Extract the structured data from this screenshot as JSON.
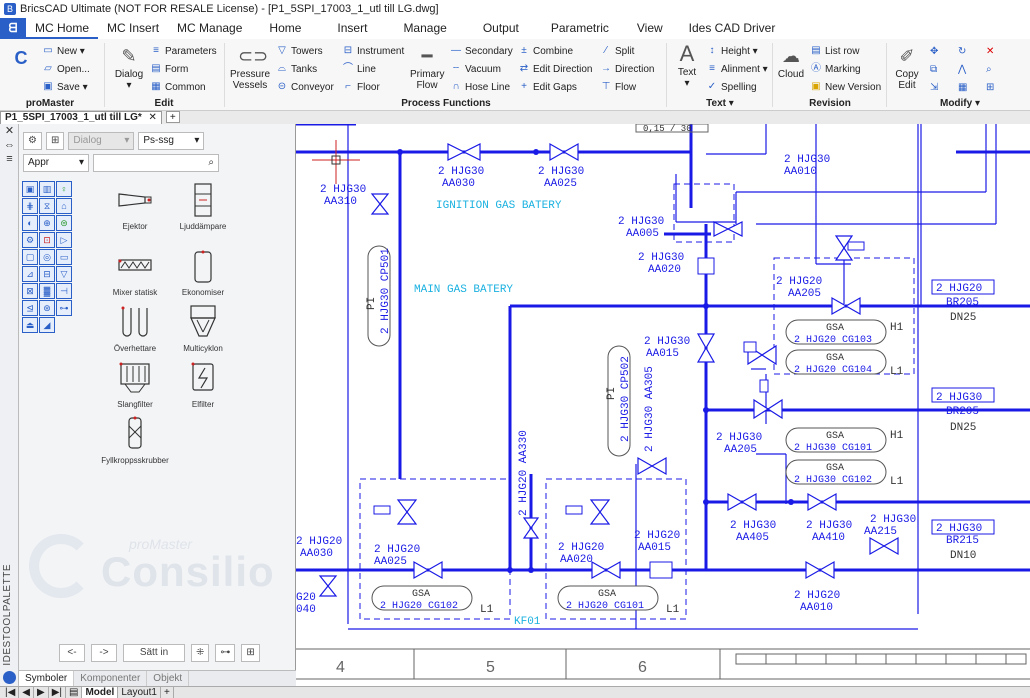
{
  "window": {
    "title": "BricsCAD Ultimate (NOT FOR RESALE License) - [P1_5SPI_17003_1_utl till LG.dwg]"
  },
  "ribbon_tabs": [
    "MC Home",
    "MC Insert",
    "MC Manage",
    "Home",
    "Insert",
    "Manage",
    "Output",
    "Parametric",
    "View",
    "Ides CAD Driver"
  ],
  "ribbon": {
    "promaster": {
      "label": "proMaster",
      "new": "New",
      "open": "Open...",
      "save": "Save"
    },
    "edit": {
      "label": "Edit",
      "dialog": "Dialog",
      "parameters": "Parameters",
      "form": "Form",
      "common": "Common"
    },
    "process": {
      "label": "Process Functions",
      "pressure_vessels": "Pressure Vessels",
      "towers": "Towers",
      "tanks": "Tanks",
      "conveyor": "Conveyor",
      "instrument": "Instrument",
      "line": "Line",
      "floor": "Floor",
      "primary_flow": "Primary Flow",
      "secondary": "Secondary",
      "vacuum": "Vacuum",
      "hose_line": "Hose Line",
      "combine": "Combine",
      "edit_direction": "Edit Direction",
      "edit_gaps": "Edit Gaps",
      "split": "Split",
      "direction": "Direction",
      "flow": "Flow"
    },
    "text": {
      "label": "Text",
      "text": "Text",
      "height": "Height",
      "alignment": "Alinment",
      "spelling": "Spelling"
    },
    "revision": {
      "label": "Revision",
      "cloud": "Cloud",
      "list_row": "List row",
      "marking": "Marking",
      "new_version": "New Version"
    },
    "modify": {
      "label": "Modify",
      "copy_edit": "Copy Edit"
    }
  },
  "doc_tab": {
    "name": "P1_5SPI_17003_1_utl till LG*"
  },
  "palette": {
    "vertical_label": "IDESTOOLPALETTE",
    "dialog_select": "Dialog",
    "std_select": "Ps-ssg",
    "appr_select": "Appr",
    "search_placeholder": "",
    "symbols": [
      "Ejektor",
      "Ljuddämpare",
      "Mixer statisk",
      "Ekonomiser",
      "Överhettare",
      "Multicyklon",
      "Slangfilter",
      "Elfilter",
      "Fyllkroppsskrubber"
    ],
    "watermark_main": "Consilio",
    "watermark_sub": "proMaster",
    "nav_prev": "<-",
    "nav_next": "->",
    "place_button": "Sätt in",
    "tabs": [
      "Symboler",
      "Komponenter",
      "Objekt"
    ]
  },
  "drawing": {
    "labels": {
      "top_box": "0,15 / 30",
      "aa030a": [
        "2 HJG30",
        "AA030"
      ],
      "aa025a": [
        "2 HJG30",
        "AA025"
      ],
      "aa010": [
        "2 HJG30",
        "AA010"
      ],
      "aa310": [
        "2 HJG30",
        "AA310"
      ],
      "ignition": "IGNITION GAS BATERY",
      "aa005": [
        "2 HJG30",
        "AA005"
      ],
      "aa020a": [
        "2 HJG30",
        "AA020"
      ],
      "cp501_pi": "PI",
      "cp501": "2 HJG30 CP501",
      "main_gas": "MAIN GAS BATERY",
      "aa205a": [
        "2 HJG20",
        "AA205"
      ],
      "br205_top": "2 HJG20",
      "br205": "BR205",
      "dn25a": "DN25",
      "gsa1": "GSA",
      "cg103": "2 HJG20 CG103",
      "h1a": "H1",
      "gsa2": "GSA",
      "cg104": "2 HJG20 CG104",
      "l1a": "L1",
      "aa015a": [
        "2 HJG30",
        "AA015"
      ],
      "cp502_pi": "PI",
      "cp502": "2 HJG30 CP502",
      "aa305": "2 HJG30 AA305",
      "br205b_top": "2 HJG30",
      "br205b": "BR205",
      "dn25b": "DN25",
      "aa205b": [
        "2 HJG30",
        "AA205"
      ],
      "gsa3": "GSA",
      "cg101a": "2 HJG30 CG101",
      "h1b": "H1",
      "gsa4": "GSA",
      "cg102a": "2 HJG30 CG102",
      "l1b": "L1",
      "aa330": "2 HJG20 AA330",
      "aa405": [
        "2 HJG30",
        "AA405"
      ],
      "aa410": [
        "2 HJG30",
        "AA410"
      ],
      "aa215": [
        "2 HJG30",
        "AA215"
      ],
      "br215_top": "2 HJG30",
      "br215": "BR215",
      "dn10": "DN10",
      "aa030b": [
        "2 HJG20",
        "AA030"
      ],
      "aa025b": [
        "2 HJG20",
        "AA025"
      ],
      "aa020b": [
        "2 HJG20",
        "AA020"
      ],
      "aa015b": [
        "2 HJG20",
        "AA015"
      ],
      "gsa5": "GSA",
      "cg102b": "2 HJG20 CG102",
      "l1c": "L1",
      "gsa6": "GSA",
      "cg101b": "2 HJG20 CG101",
      "l1d": "L1",
      "kf01": "KF01",
      "aa010b": [
        "2 HJG20",
        "AA010"
      ],
      "g20": [
        "G20",
        "040"
      ],
      "col4": "4",
      "col5": "5",
      "col6": "6"
    }
  },
  "layout_tabs": [
    "Model",
    "Layout1",
    "+"
  ]
}
